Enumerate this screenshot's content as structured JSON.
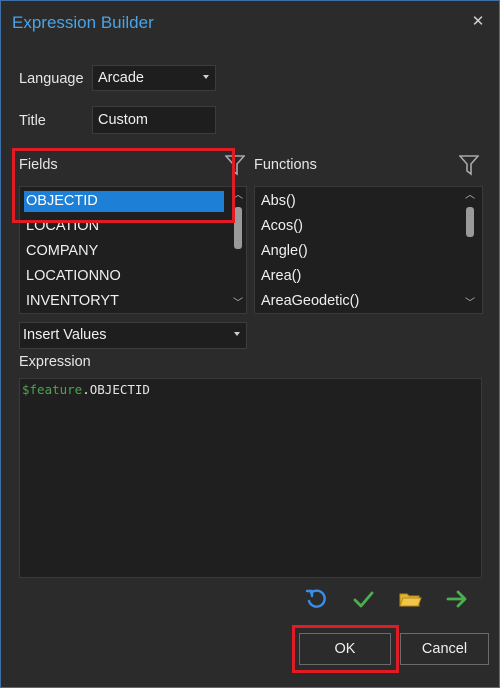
{
  "dialog": {
    "title": "Expression Builder",
    "close_glyph": "✕"
  },
  "language": {
    "label": "Language",
    "value": "Arcade"
  },
  "title_field": {
    "label": "Title",
    "value": "Custom"
  },
  "fields": {
    "label": "Fields",
    "items": [
      "OBJECTID",
      "LOCATION",
      "COMPANY",
      "LOCATIONNO",
      "INVENTORYT"
    ],
    "selected_index": 0
  },
  "functions": {
    "label": "Functions",
    "items": [
      "Abs()",
      "Acos()",
      "Angle()",
      "Area()",
      "AreaGeodetic()"
    ]
  },
  "insert_values": {
    "value": "Insert Values"
  },
  "expression": {
    "label": "Expression",
    "code_keyword": "$feature",
    "code_rest": ".OBJECTID"
  },
  "toolbar": {
    "icons": [
      "undo-icon",
      "check-icon",
      "folder-icon",
      "arrow-right-icon"
    ],
    "colors": {
      "undo": "#3a8ee6",
      "check": "#4caf50",
      "folder": "#e2b232",
      "arrow": "#4caf50"
    }
  },
  "buttons": {
    "ok_label": "OK",
    "cancel_label": "Cancel"
  },
  "colors": {
    "accent": "#4aa3e8",
    "selection": "#1e7fd6",
    "highlight_outline": "#e01b24"
  },
  "scroll": {
    "fields_position": 0,
    "functions_position": 0
  }
}
